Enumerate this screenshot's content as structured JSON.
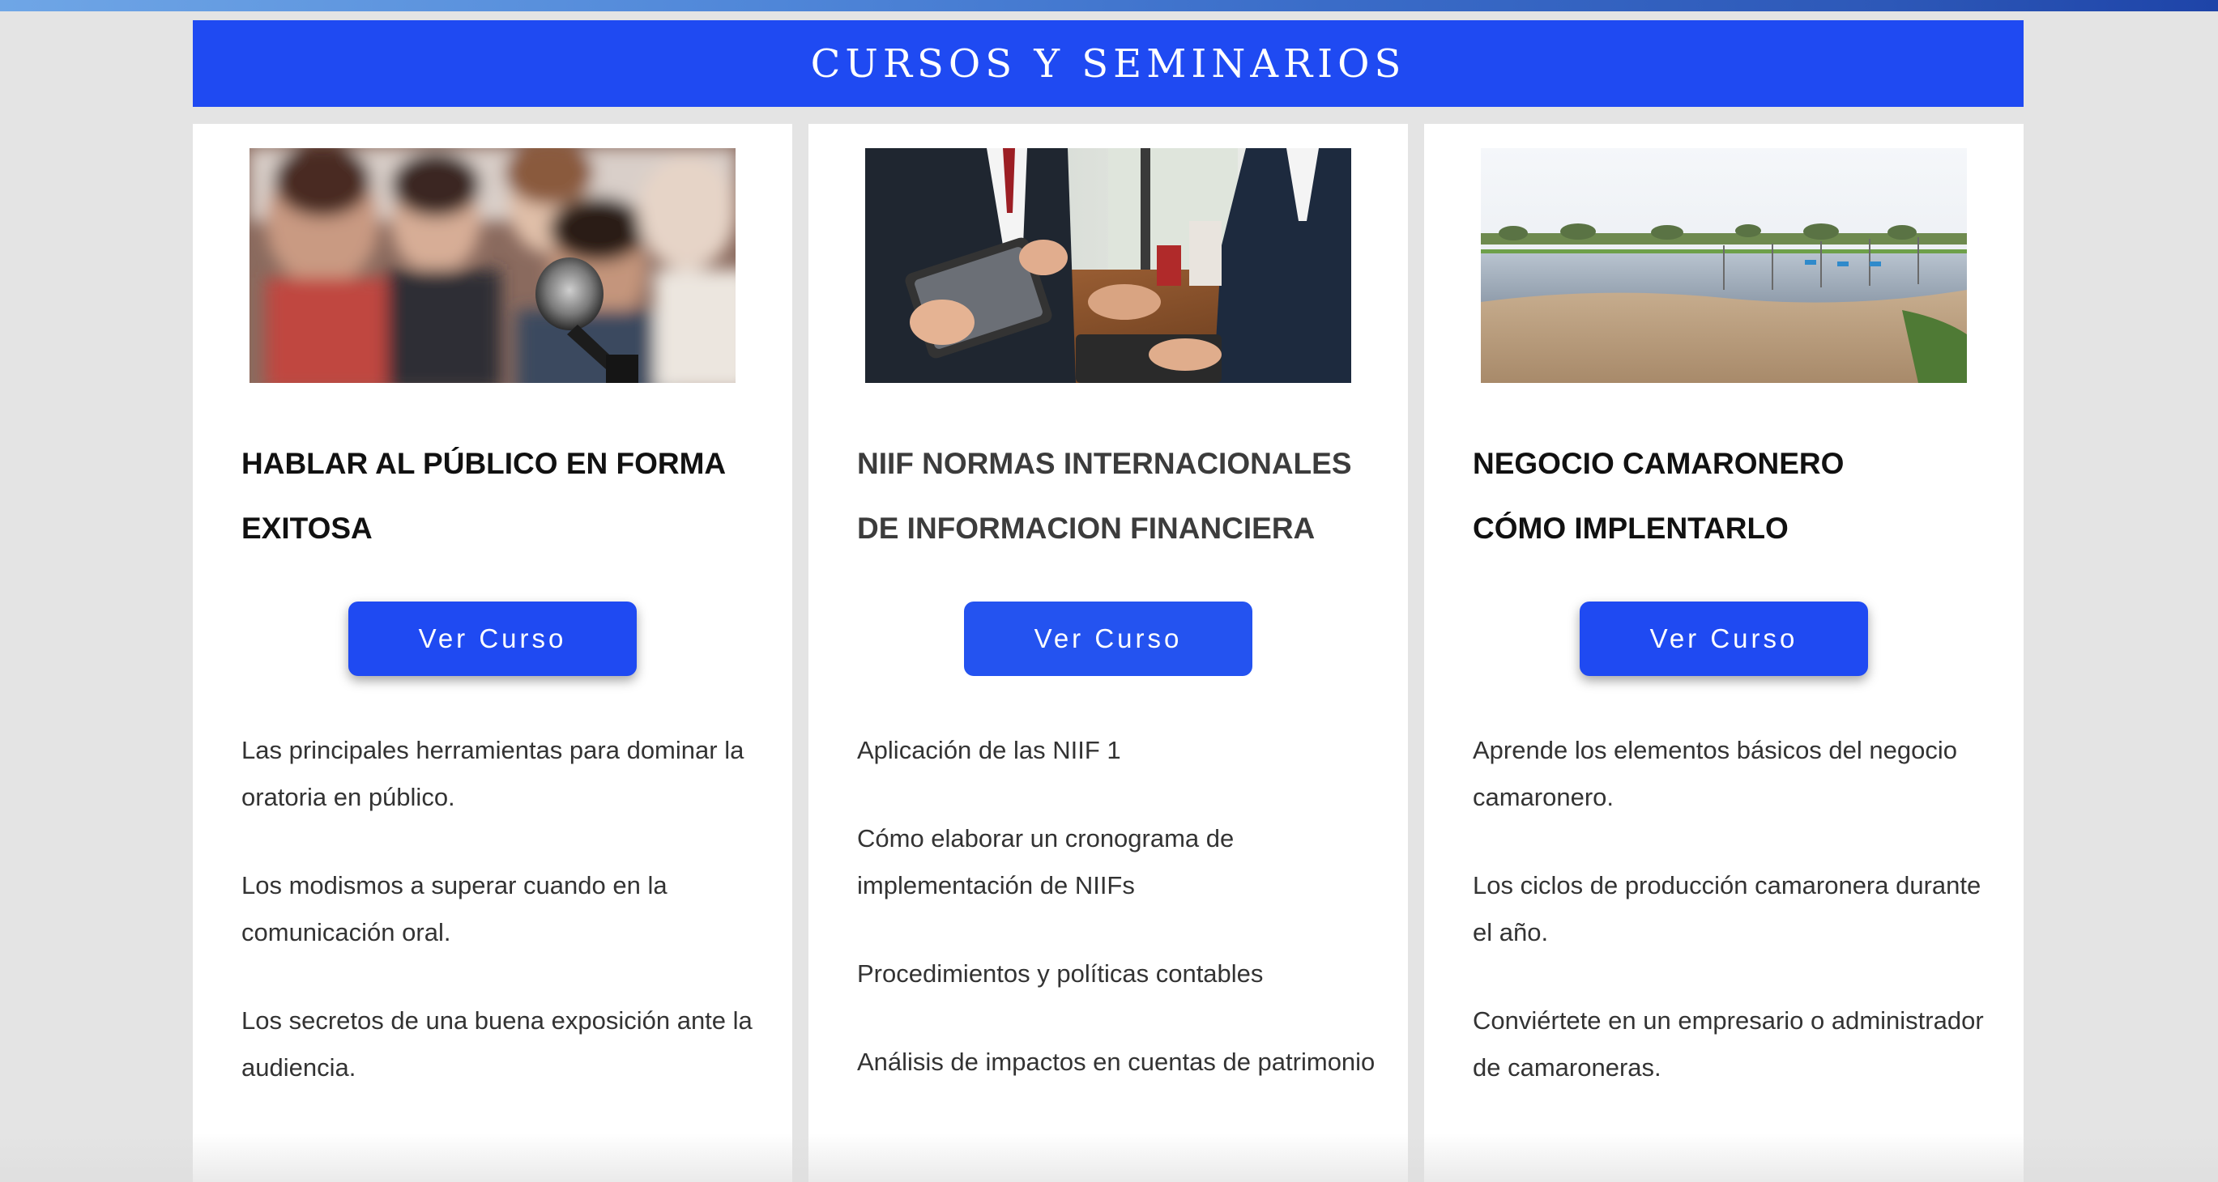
{
  "header": {
    "title": "CURSOS Y SEMINARIOS"
  },
  "courses": [
    {
      "image": "public-speaking-audience-microphone-photo",
      "title_lines": [
        "HABLAR AL PÚBLICO EN FORMA",
        "EXITOSA"
      ],
      "button_label": "Ver Curso",
      "paragraphs": [
        "Las principales herramientas para dominar la oratoria en público.",
        "Los modismos a superar cuando en la comunicación oral.",
        "Los secretos de una buena exposición ante la audiencia."
      ]
    },
    {
      "image": "business-meeting-tablet-photo",
      "title_lines": [
        "NIIF NORMAS INTERNACIONALES",
        "DE INFORMACION FINANCIERA"
      ],
      "button_label": "Ver Curso",
      "paragraphs": [
        "Aplicación de las NIIF 1",
        "Cómo elaborar un cronograma de implementación de NIIFs",
        "Procedimientos y políticas contables",
        "Análisis de impactos en cuentas de patrimonio"
      ]
    },
    {
      "image": "shrimp-farm-pond-photo",
      "title_lines": [
        "NEGOCIO CAMARONERO",
        "CÓMO IMPLENTARLO"
      ],
      "button_label": "Ver Curso",
      "paragraphs": [
        "Aprende los elementos básicos del negocio camaronero.",
        "Los ciclos de producción camaronera durante el año.",
        "Conviértete en un empresario o administrador de camaroneras."
      ]
    }
  ],
  "colors": {
    "brand_blue": "#1f4af2",
    "page_bg": "#e4e4e4",
    "card_bg": "#ffffff"
  }
}
